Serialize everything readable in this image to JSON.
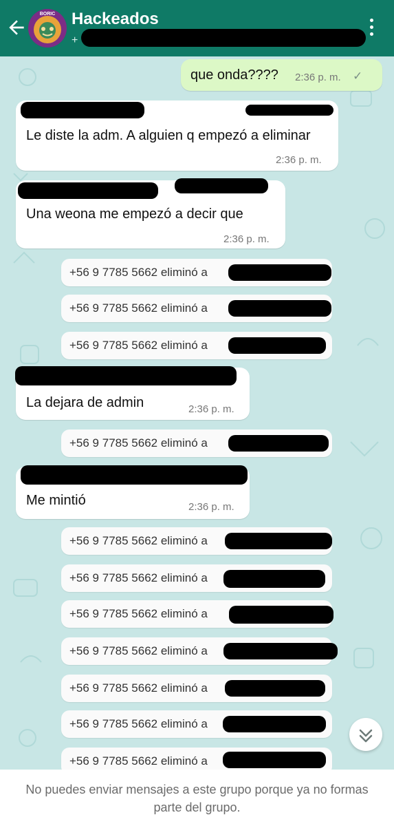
{
  "header": {
    "title": "Hackeados",
    "subtitle_prefix": "+",
    "avatar_label": "BORIC"
  },
  "messages": {
    "outgoing": {
      "text": "que onda????",
      "time": "2:36 p. m."
    },
    "incoming": [
      {
        "text": "Le diste la adm. A alguien q empezó a eliminar",
        "time": "2:36 p. m."
      },
      {
        "text": "Una weona me empezó a decir que",
        "time": "2:36 p. m."
      },
      {
        "text": "La dejara de admin",
        "time": "2:36 p. m."
      },
      {
        "text": "Me mintió",
        "time": "2:36 p. m."
      }
    ],
    "system_text": "+56 9 7785 5662 eliminó a"
  },
  "footer": {
    "notice": "No puedes enviar mensajes a este grupo porque ya no formas parte del grupo."
  },
  "colors": {
    "header": "#0f7a66",
    "chat_background": "#c8e6e5",
    "outgoing_bubble": "#dcf8c6",
    "incoming_bubble": "#ffffff"
  },
  "icons": [
    "back-arrow-icon",
    "more-vert-icon",
    "scroll-down-icon",
    "read-check-icon"
  ]
}
